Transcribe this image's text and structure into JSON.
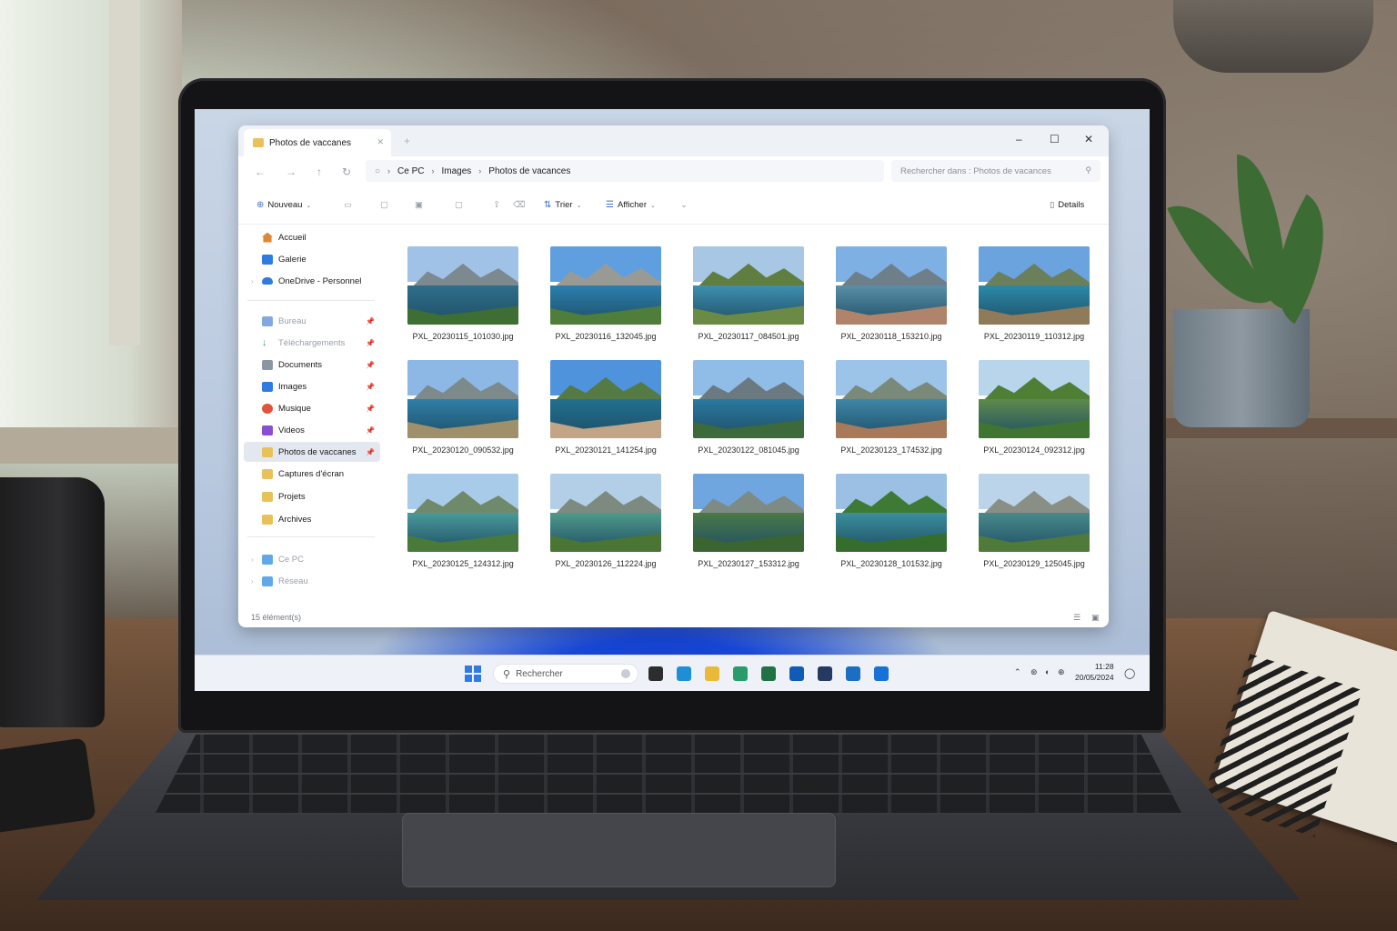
{
  "window": {
    "tab_title": "Photos de vaccanes",
    "controls": {
      "minimize": "–",
      "maximize": "☐",
      "close": "✕"
    }
  },
  "nav": {
    "breadcrumb": [
      "Ce PC",
      "Images",
      "Photos de vacances"
    ],
    "search_placeholder": "Rechercher dans : Photos de vacances"
  },
  "toolbar": {
    "new_label": "Nouveau",
    "sort_label": "Trier",
    "view_label": "Afficher",
    "details_label": "Details"
  },
  "sidebar": {
    "top": [
      {
        "label": "Accueil",
        "icon": "home-icon",
        "color": "#e0863a"
      },
      {
        "label": "Galerie",
        "icon": "gallery-icon",
        "color": "#2f7be0"
      },
      {
        "label": "OneDrive - Personnel",
        "icon": "cloud-icon",
        "color": "#2f7be0"
      }
    ],
    "quick": [
      {
        "label": "Bureau",
        "icon": "desktop-icon",
        "color": "#7fa9e0",
        "pinned": true,
        "dim": true
      },
      {
        "label": "Téléchargements",
        "icon": "download-icon",
        "color": "#2f9e6a",
        "pinned": true,
        "dim": true
      },
      {
        "label": "Documents",
        "icon": "documents-icon",
        "color": "#8c96a3",
        "pinned": true
      },
      {
        "label": "Images",
        "icon": "images-icon",
        "color": "#2f7be0",
        "pinned": true
      },
      {
        "label": "Musique",
        "icon": "music-icon",
        "color": "#e0543a",
        "pinned": true
      },
      {
        "label": "Videos",
        "icon": "videos-icon",
        "color": "#8a4fd0",
        "pinned": true
      },
      {
        "label": "Photos de vaccanes",
        "icon": "folder-icon",
        "color": "#e9c15a",
        "pinned": true,
        "selected": true
      },
      {
        "label": "Captures d'écran",
        "icon": "folder-icon",
        "color": "#e9c15a"
      },
      {
        "label": "Projets",
        "icon": "folder-icon",
        "color": "#e9c15a"
      },
      {
        "label": "Archives",
        "icon": "folder-icon",
        "color": "#e9c15a"
      }
    ],
    "bottom": [
      {
        "label": "Ce PC",
        "icon": "computer-icon",
        "color": "#5fa9e8"
      },
      {
        "label": "Réseau",
        "icon": "network-icon",
        "color": "#5fa9e8"
      }
    ]
  },
  "files": [
    {
      "name": "PXL_20230115_101030.jpg",
      "sky": "#9fc2e6",
      "mtn": "#7c8a8f",
      "water": "#2f6e8a",
      "green": "#3f6e34"
    },
    {
      "name": "PXL_20230116_132045.jpg",
      "sky": "#5f9fe0",
      "mtn": "#9a9a94",
      "water": "#2b7fae",
      "green": "#4f7d3a"
    },
    {
      "name": "PXL_20230117_084501.jpg",
      "sky": "#a7c7e4",
      "mtn": "#5f7e3f",
      "water": "#3f8fb0",
      "green": "#6a8a45"
    },
    {
      "name": "PXL_20230118_153210.jpg",
      "sky": "#7fb0e3",
      "mtn": "#6e7f8a",
      "water": "#5a8fa8",
      "green": "#b0846a"
    },
    {
      "name": "PXL_20230119_110312.jpg",
      "sky": "#6aa3dd",
      "mtn": "#6b7f5a",
      "water": "#2a8aa8",
      "green": "#8f7a5a"
    },
    {
      "name": "PXL_20230120_090532.jpg",
      "sky": "#8db8e6",
      "mtn": "#7d8a8c",
      "water": "#2f7fa8",
      "green": "#a0906a"
    },
    {
      "name": "PXL_20230121_141254.jpg",
      "sky": "#4f93dc",
      "mtn": "#567a43",
      "water": "#226f8f",
      "green": "#c2a585"
    },
    {
      "name": "PXL_20230122_081045.jpg",
      "sky": "#8fbde8",
      "mtn": "#6a7a80",
      "water": "#2a7aa0",
      "green": "#3c6a3a"
    },
    {
      "name": "PXL_20230123_174532.jpg",
      "sky": "#9cc3e8",
      "mtn": "#7a8a7a",
      "water": "#3f86a8",
      "green": "#a87a5a"
    },
    {
      "name": "PXL_20230124_092312.jpg",
      "sky": "#b9d5ec",
      "mtn": "#4f7f35",
      "water": "#5f8a4a",
      "green": "#3f7530"
    },
    {
      "name": "PXL_20230125_124312.jpg",
      "sky": "#a9cbea",
      "mtn": "#6f8a6a",
      "water": "#4a9a9a",
      "green": "#4a7a3a"
    },
    {
      "name": "PXL_20230126_112224.jpg",
      "sky": "#b3cfe8",
      "mtn": "#7d8a80",
      "water": "#4f9a8a",
      "green": "#4a7535"
    },
    {
      "name": "PXL_20230127_153312.jpg",
      "sky": "#6fa6e0",
      "mtn": "#7e8a84",
      "water": "#4a7a45",
      "green": "#3a6530"
    },
    {
      "name": "PXL_20230128_101532.jpg",
      "sky": "#9cc0e4",
      "mtn": "#3f7a35",
      "water": "#3a8f9a",
      "green": "#356e2c"
    },
    {
      "name": "PXL_20230129_125045.jpg",
      "sky": "#bcd4ea",
      "mtn": "#8a8f86",
      "water": "#4a8a8a",
      "green": "#4f7a3a"
    }
  ],
  "status": {
    "count": "15 élément(s)"
  },
  "taskbar": {
    "search_label": "Rechercher",
    "time": "11:28",
    "date": "20/05/2024",
    "apps": [
      {
        "icon": "file-explorer-icon",
        "color": "#2d2d2d"
      },
      {
        "icon": "edge-icon",
        "color": "#1e8fd6"
      },
      {
        "icon": "folder-app-icon",
        "color": "#e9b93a"
      },
      {
        "icon": "store-icon",
        "color": "#2a9b6a"
      },
      {
        "icon": "excel-icon",
        "color": "#207245"
      },
      {
        "icon": "mail-icon",
        "color": "#0f5bb5"
      },
      {
        "icon": "photos-icon",
        "color": "#243a63"
      },
      {
        "icon": "outlook-icon",
        "color": "#1b6ec2"
      },
      {
        "icon": "teams-icon",
        "color": "#1672d6"
      }
    ]
  }
}
